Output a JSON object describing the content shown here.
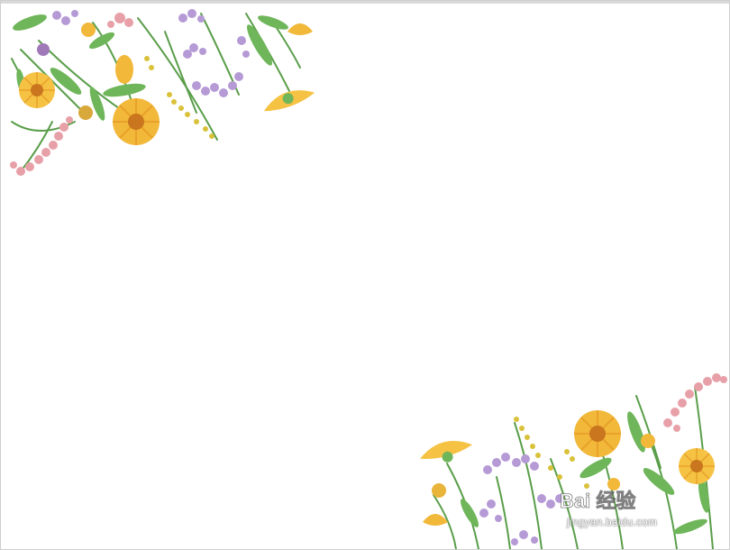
{
  "slide": {
    "background": "#ffffff",
    "border_color": "#cfcfcf"
  },
  "decorations": {
    "top_left": "watercolor-wildflower-border-top-left",
    "bottom_right": "watercolor-wildflower-border-bottom-right",
    "colors": {
      "stem": "#5a9e4a",
      "leaf": "#6fb65a",
      "marigold": "#f2b83a",
      "marigold_center": "#c9761e",
      "lavender": "#b59ad6",
      "pink": "#e8a0a8",
      "goldenrod": "#d9c23a"
    }
  },
  "watermark": {
    "logo_text": "Bai 经验",
    "url": "jingyan.baidu.com"
  }
}
